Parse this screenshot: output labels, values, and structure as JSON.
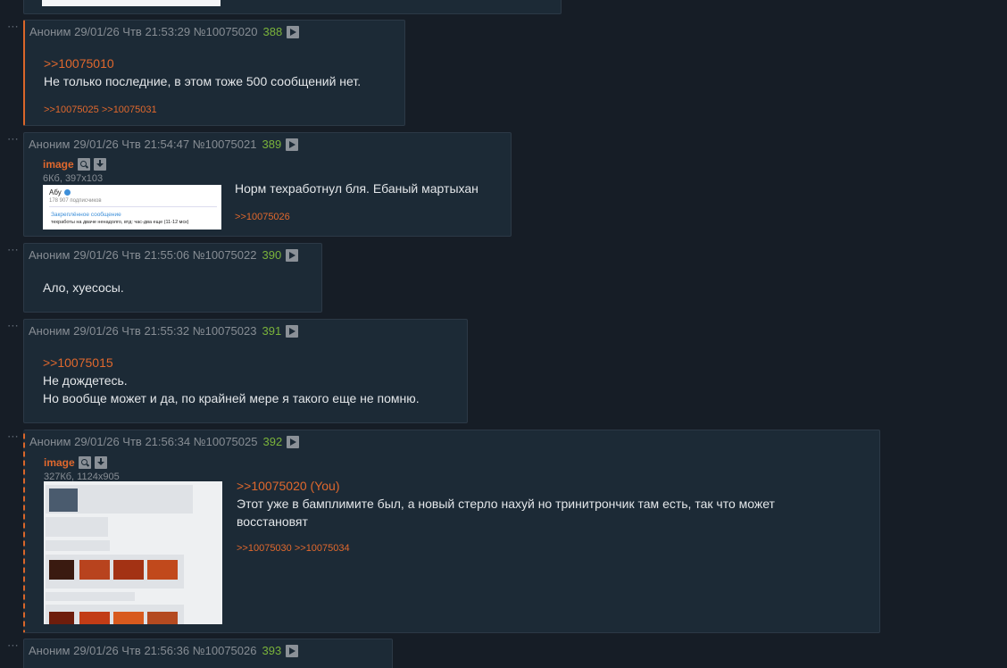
{
  "posts": [
    {
      "author": "Аноним",
      "datetime": "29/01/26 Чтв 21:53:29",
      "id": "№10075020",
      "index": "388",
      "lines": [
        "Не только последние, в этом тоже 500 сообщений нет."
      ],
      "quote": ">>10075010",
      "replies": ">>10075025 >>10075031"
    },
    {
      "author": "Аноним",
      "datetime": "29/01/26 Чтв 21:54:47",
      "id": "№10075021",
      "index": "389",
      "image_label": "image",
      "image_size": "6Кб, 397x103",
      "thumb": {
        "name": "Абу",
        "subs": "178 907 подписчиков",
        "pinned": "Закреплённое сообщение",
        "msg": "техработы на двачe ненадолго, втд: час-два еще (11-12 мск)"
      },
      "lines": [
        "Норм техработнул бля. Ебаный мартыхан"
      ],
      "replies": ">>10075026"
    },
    {
      "author": "Аноним",
      "datetime": "29/01/26 Чтв 21:55:06",
      "id": "№10075022",
      "index": "390",
      "lines": [
        "Ало, хуесосы."
      ]
    },
    {
      "author": "Аноним",
      "datetime": "29/01/26 Чтв 21:55:32",
      "id": "№10075023",
      "index": "391",
      "quote": ">>10075015",
      "lines": [
        "Не дождетесь.",
        "Но вообще может и да, по крайней мере я такого еще не помню."
      ]
    },
    {
      "author": "Аноним",
      "datetime": "29/01/26 Чтв 21:56:34",
      "id": "№10075025",
      "index": "392",
      "image_label": "image",
      "image_size": "327Кб, 1124x905",
      "quote": ">>10075020 (You)",
      "lines": [
        "Этот уже в бамплимите был, а новый стерло нахуй но тринитрончик там есть, так что может",
        "восстановят"
      ],
      "replies": ">>10075030 >>10075034"
    },
    {
      "author": "Аноним",
      "datetime": "29/01/26 Чтв 21:56:36",
      "id": "№10075026",
      "index": "393"
    }
  ],
  "colors": {
    "accent": "#e0682d",
    "number": "#7ab33b",
    "background": "#161d26",
    "post_bg": "#1c2a36"
  },
  "icons": {
    "play": "play-icon",
    "search": "search-icon",
    "download": "download-icon",
    "menu": "dots-menu-icon"
  }
}
